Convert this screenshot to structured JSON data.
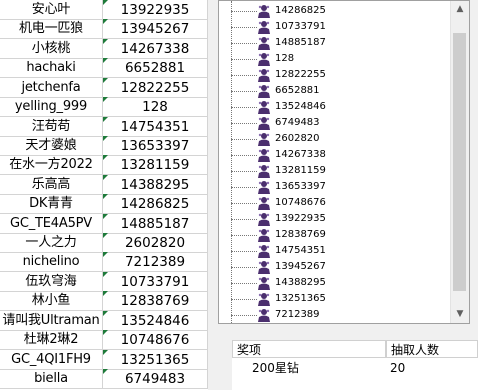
{
  "sheet": {
    "rows": [
      {
        "name": "安心叶",
        "number": "13922935"
      },
      {
        "name": "机电一匹狼",
        "number": "13945267"
      },
      {
        "name": "小核桃",
        "number": "14267338"
      },
      {
        "name": "hachaki",
        "number": "6652881"
      },
      {
        "name": "jetchenfa",
        "number": "12822255"
      },
      {
        "name": "yelling_999",
        "number": "128"
      },
      {
        "name": "汪苟苟",
        "number": "14754351"
      },
      {
        "name": "天才婆娘",
        "number": "13653397"
      },
      {
        "name": "在水一方2022",
        "number": "13281159"
      },
      {
        "name": "乐高高",
        "number": "14388295"
      },
      {
        "name": "DK青青",
        "number": "14286825"
      },
      {
        "name": "GC_TE4A5PV",
        "number": "14885187"
      },
      {
        "name": "一人之力",
        "number": "2602820"
      },
      {
        "name": "nichelino",
        "number": "7212389"
      },
      {
        "name": "伍玖穹海",
        "number": "10733791"
      },
      {
        "name": "林小鱼",
        "number": "12838769"
      },
      {
        "name": "请叫我Ultraman",
        "number": "13524846"
      },
      {
        "name": "杜琳2琳2",
        "number": "10748676"
      },
      {
        "name": "GC_4QI1FH9",
        "number": "13251365"
      },
      {
        "name": "biella",
        "number": "6749483"
      }
    ]
  },
  "tree": {
    "items": [
      "14286825",
      "10733791",
      "14885187",
      "128",
      "12822255",
      "6652881",
      "13524846",
      "6749483",
      "2602820",
      "14267338",
      "13281159",
      "13653397",
      "10748676",
      "13922935",
      "12838769",
      "14754351",
      "13945267",
      "14388295",
      "13251365",
      "7212389"
    ]
  },
  "prize_table": {
    "headers": [
      "奖项",
      "抽取人数"
    ],
    "row": {
      "prize": "200星钻",
      "count": "20"
    }
  },
  "icons": {
    "tree_item": "user-icon",
    "scroll_up": "triangle-up-icon",
    "scroll_down": "triangle-down-icon"
  },
  "colors": {
    "note_marker": "#1e7a3a",
    "tree_icon": "#4b2f6e"
  }
}
